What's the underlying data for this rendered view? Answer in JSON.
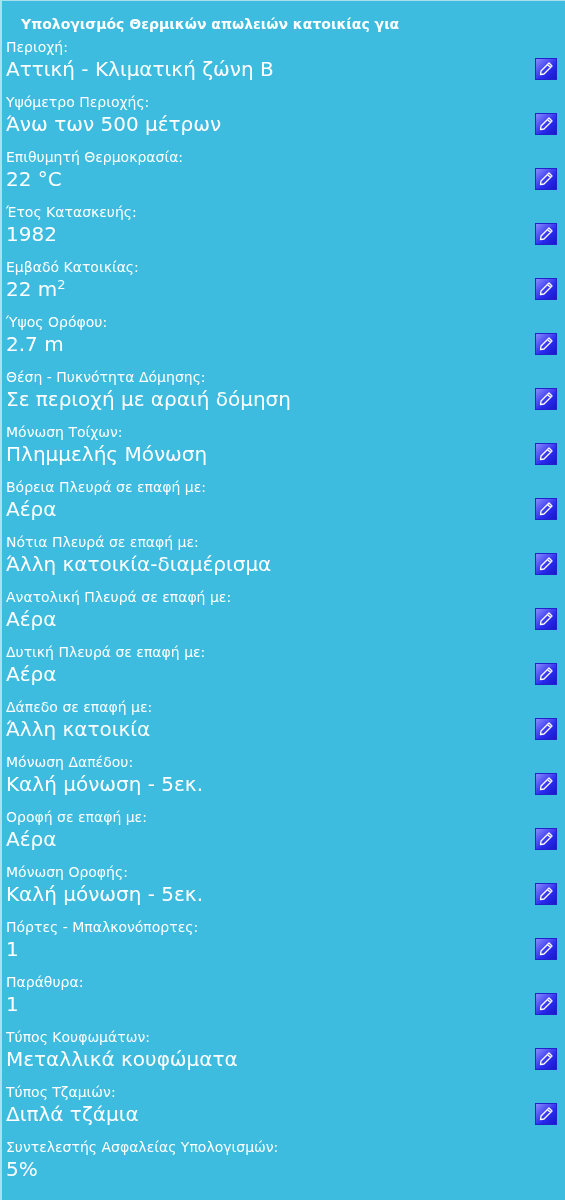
{
  "title": "Υπολογισμός Θερμικών απωλειών κατοικίας για",
  "fields": [
    {
      "label": "Περιοχή:",
      "value": "Αττική - Κλιματική ζώνη Β",
      "editable": true
    },
    {
      "label": "Υψόμετρο Περιοχής:",
      "value": "Άνω των 500 μέτρων",
      "editable": true
    },
    {
      "label": "Επιθυμητή Θερμοκρασία:",
      "value": "22 °C",
      "editable": true
    },
    {
      "label": "Έτος Κατασκευής:",
      "value": "1982",
      "editable": true
    },
    {
      "label": "Εμβαδό Κατοικίας:",
      "value": "22 m$^{2}$",
      "editable": true
    },
    {
      "label": "Ύψος Ορόφου:",
      "value": "2.7 m",
      "editable": true
    },
    {
      "label": "Θέση - Πυκνότητα Δόμησης:",
      "value": "Σε περιοχή με αραιή δόμηση",
      "editable": true
    },
    {
      "label": "Μόνωση Τοίχων:",
      "value": "Πλημμελής Μόνωση",
      "editable": true
    },
    {
      "label": "Βόρεια Πλευρά σε επαφή με:",
      "value": "Αέρα",
      "editable": true
    },
    {
      "label": "Νότια Πλευρά σε επαφή με:",
      "value": "Άλλη κατοικία-διαμέρισμα",
      "editable": true
    },
    {
      "label": "Ανατολική Πλευρά σε επαφή με:",
      "value": "Αέρα",
      "editable": true
    },
    {
      "label": "Δυτική Πλευρά σε επαφή με:",
      "value": "Αέρα",
      "editable": true
    },
    {
      "label": "Δάπεδο σε επαφή με:",
      "value": "Άλλη κατοικία",
      "editable": true
    },
    {
      "label": "Μόνωση Δαπέδου:",
      "value": "Καλή μόνωση - 5εκ.",
      "editable": true
    },
    {
      "label": "Οροφή σε επαφή με:",
      "value": "Αέρα",
      "editable": true
    },
    {
      "label": "Μόνωση Οροφής:",
      "value": "Καλή μόνωση - 5εκ.",
      "editable": true
    },
    {
      "label": "Πόρτες - Μπαλκονόπορτες:",
      "value": "1",
      "editable": true
    },
    {
      "label": "Παράθυρα:",
      "value": "1",
      "editable": true
    },
    {
      "label": "Τύπος Κουφωμάτων:",
      "value": "Μεταλλικά κουφώματα",
      "editable": true
    },
    {
      "label": "Τύπος Τζαμιών:",
      "value": "Διπλά τζάμια",
      "editable": true
    },
    {
      "label": "Συντελεστής Ασφαλείας Υπολογισμών:",
      "value": "5%",
      "editable": false
    }
  ]
}
